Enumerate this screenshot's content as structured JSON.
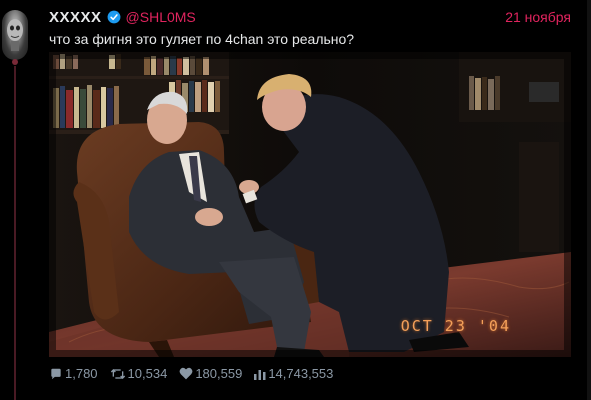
{
  "author": {
    "display_name": "XXXXX",
    "handle": "@SHL0MS",
    "verified": true
  },
  "post": {
    "date": "21 ноября",
    "text": "что за фигня это гуляет по 4chan это реально?",
    "image": {
      "date_stamp": "OCT 23 '04",
      "description_icon": "photo-image"
    }
  },
  "stats": {
    "replies": "1,780",
    "reposts": "10,534",
    "likes": "180,559",
    "views": "14,743,553"
  },
  "colors": {
    "accent": "#e0245e",
    "verified": "#1d9bf0",
    "muted": "#8b98a5",
    "background": "#000000"
  }
}
